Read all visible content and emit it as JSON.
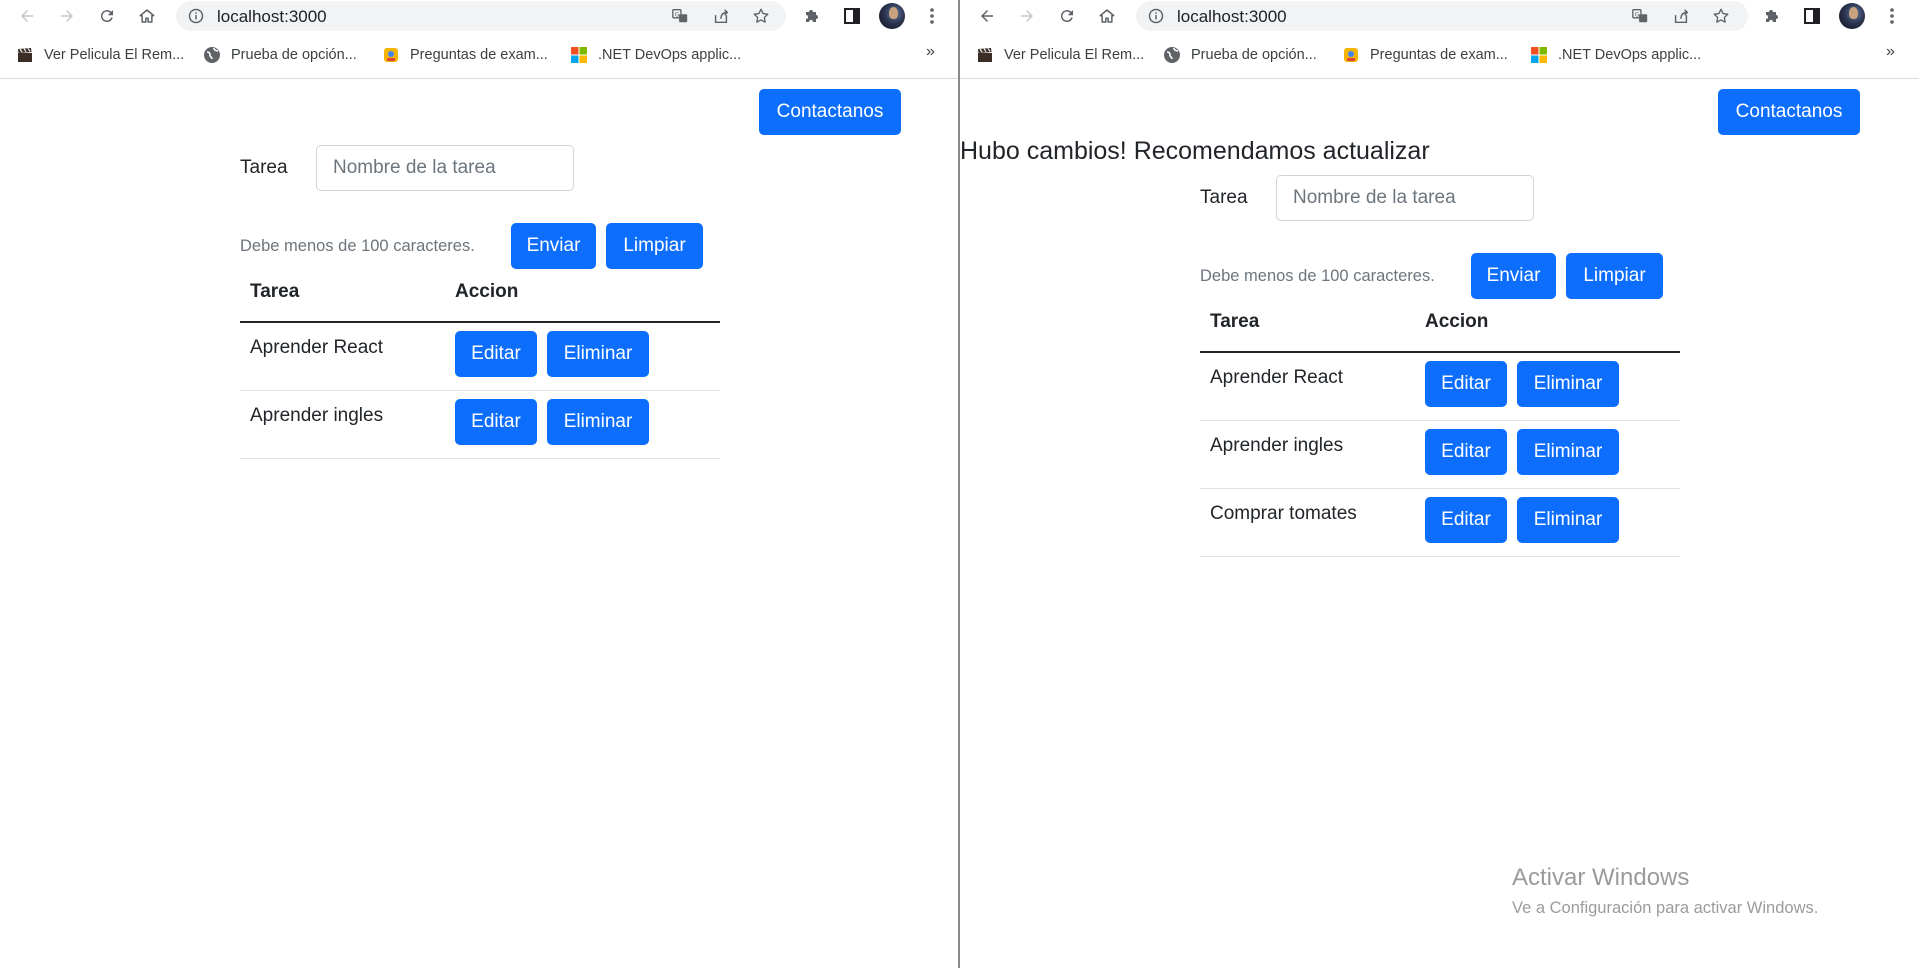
{
  "browser": {
    "url": "localhost:3000",
    "bookmarks": [
      {
        "label": "Ver Pelicula El Rem...",
        "icon": "film-clapper-icon"
      },
      {
        "label": "Prueba de opción...",
        "icon": "globe-icon"
      },
      {
        "label": "Preguntas de exam...",
        "icon": "quiz-app-icon"
      },
      {
        "label": ".NET DevOps applic...",
        "icon": "microsoft-icon"
      }
    ],
    "more_bookmarks": "»"
  },
  "left_window": {
    "contact_label": "Contactanos",
    "form": {
      "label": "Tarea",
      "placeholder": "Nombre de la tarea",
      "value": "",
      "help": "Debe menos de 100 caracteres.",
      "send_label": "Enviar",
      "clear_label": "Limpiar"
    },
    "table": {
      "headers": [
        "Tarea",
        "Accion"
      ],
      "rows": [
        {
          "task": "Aprender React",
          "edit": "Editar",
          "delete": "Eliminar"
        },
        {
          "task": "Aprender ingles",
          "edit": "Editar",
          "delete": "Eliminar"
        }
      ]
    }
  },
  "right_window": {
    "contact_label": "Contactanos",
    "banner": "Hubo cambios! Recomendamos actualizar",
    "form": {
      "label": "Tarea",
      "placeholder": "Nombre de la tarea",
      "value": "",
      "help": "Debe menos de 100 caracteres.",
      "send_label": "Enviar",
      "clear_label": "Limpiar"
    },
    "table": {
      "headers": [
        "Tarea",
        "Accion"
      ],
      "rows": [
        {
          "task": "Aprender React",
          "edit": "Editar",
          "delete": "Eliminar"
        },
        {
          "task": "Aprender ingles",
          "edit": "Editar",
          "delete": "Eliminar"
        },
        {
          "task": "Comprar tomates",
          "edit": "Editar",
          "delete": "Eliminar"
        }
      ]
    },
    "watermark": {
      "title": "Activar Windows",
      "subtitle": "Ve a Configuración para activar Windows."
    }
  },
  "colors": {
    "primary": "#0d6efd",
    "banner_text": "#212529",
    "muted": "#6c757d"
  }
}
